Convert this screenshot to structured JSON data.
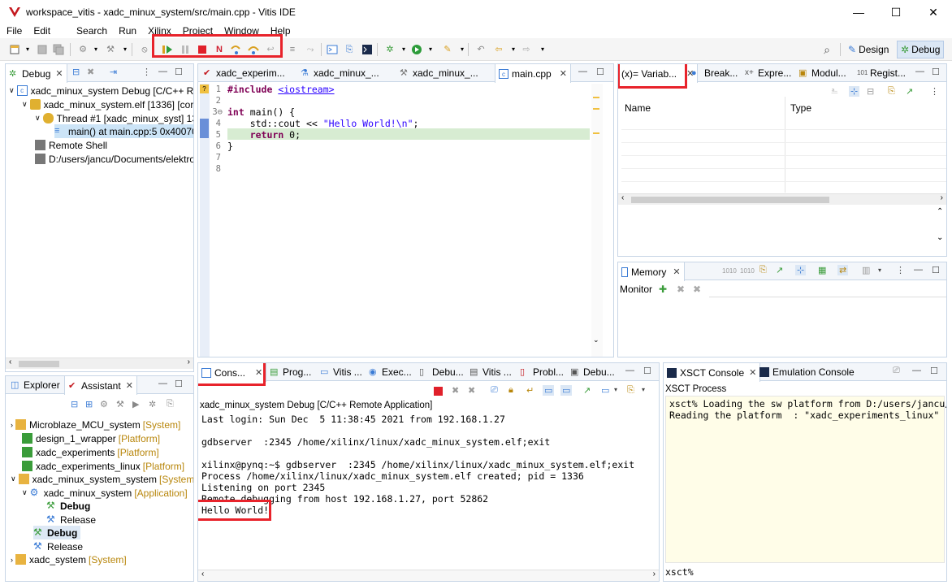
{
  "window": {
    "title": "workspace_vitis - xadc_minux_system/src/main.cpp - Vitis IDE",
    "minimize_glyph": "—",
    "maximize_glyph": "☐",
    "close_glyph": "✕"
  },
  "menu": [
    "File",
    "Edit",
    "Search",
    "Run",
    "Xilinx",
    "Project",
    "Window",
    "Help"
  ],
  "perspectives": {
    "design": "Design",
    "debug": "Debug"
  },
  "debug_view": {
    "tab": "Debug",
    "rows": [
      "xadc_minux_system Debug [C/C++ Rer",
      "xadc_minux_system.elf [1336] [cores",
      "Thread #1 [xadc_minux_syst] 133(",
      "main() at main.cpp:5 0x400700",
      "Remote Shell",
      "D:/users/jancu/Documents/elektron"
    ]
  },
  "editor": {
    "tabs": [
      "xadc_experim...",
      "xadc_minux_...",
      "xadc_minux_...",
      "main.cpp"
    ],
    "lines": [
      {
        "no": "1",
        "text": "#include <iostream>"
      },
      {
        "no": "2",
        "text": ""
      },
      {
        "no": "3⊖",
        "text": "int main() {"
      },
      {
        "no": "4",
        "text": "    std::cout << \"Hello World!\\n\";"
      },
      {
        "no": "5",
        "text": "    return 0;"
      },
      {
        "no": "6",
        "text": "}"
      },
      {
        "no": "7",
        "text": ""
      },
      {
        "no": "8",
        "text": ""
      }
    ],
    "include_kw": "#include",
    "include_file": "<iostream>",
    "int_kw": "int",
    "main_sig": " main() {",
    "cout": "std::cout << ",
    "hello_str": "\"Hello World!\\n\"",
    "semicolon": ";",
    "return_kw": "return",
    "return_rest": " 0;",
    "close_brace": "}"
  },
  "variables_view": {
    "tabs": [
      "(x)= Variab...",
      "Break...",
      "Expre...",
      "Modul...",
      "Regist..."
    ],
    "col_name": "Name",
    "col_type": "Type"
  },
  "memory_view": {
    "tab": "Memory",
    "monitor": "Monitor"
  },
  "explorer": {
    "tabs": [
      "Explorer",
      "Assistant"
    ],
    "rows": [
      {
        "label": "Microblaze_MCU_system",
        "tag": "[System]"
      },
      {
        "label": "design_1_wrapper",
        "tag": "[Platform]"
      },
      {
        "label": "xadc_experiments",
        "tag": "[Platform]"
      },
      {
        "label": "xadc_experiments_linux",
        "tag": "[Platform]"
      },
      {
        "label": "xadc_minux_system_system",
        "tag": "[System]"
      },
      {
        "label": "xadc_minux_system",
        "tag": "[Application]"
      },
      {
        "label": "Debug",
        "tag": ""
      },
      {
        "label": "Release",
        "tag": ""
      },
      {
        "label": "Debug",
        "tag": ""
      },
      {
        "label": "Release",
        "tag": ""
      },
      {
        "label": "xadc_system",
        "tag": "[System]"
      }
    ]
  },
  "console": {
    "tabs": [
      "Cons...",
      "Prog...",
      "Vitis ...",
      "Exec...",
      "Debu...",
      "Vitis ...",
      "Probl...",
      "Debu..."
    ],
    "header": "xadc_minux_system Debug [C/C++ Remote Application]",
    "lines": [
      "Last login: Sun Dec  5 11:38:45 2021 from 192.168.1.27",
      "",
      "gdbserver  :2345 /home/xilinx/linux/xadc_minux_system.elf;exit",
      "",
      "xilinx@pynq:~$ gdbserver  :2345 /home/xilinx/linux/xadc_minux_system.elf;exit",
      "Process /home/xilinx/linux/xadc_minux_system.elf created; pid = 1336",
      "Listening on port 2345",
      "Remote debugging from host 192.168.1.27, port 52862",
      "Hello World!"
    ]
  },
  "xsct": {
    "tabs": [
      "XSCT Console",
      "Emulation Console"
    ],
    "header": "XSCT Process",
    "lines": [
      "xsct% Loading the sw platform from D:/users/jancu/",
      "Reading the platform  : \"xadc_experiments_linux\""
    ],
    "prompt": "xsct%"
  }
}
